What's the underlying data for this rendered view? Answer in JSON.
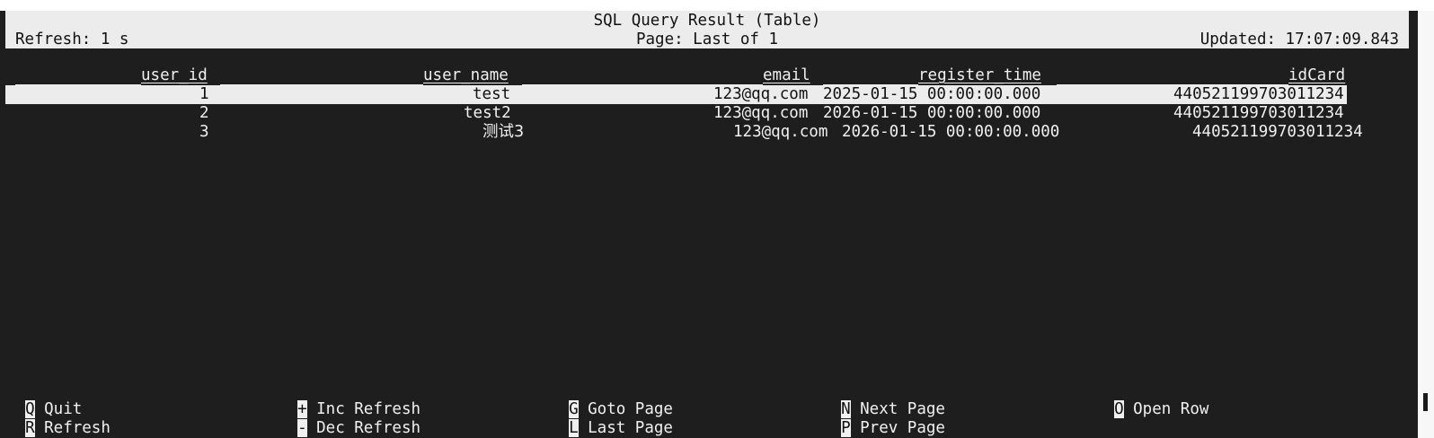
{
  "header": {
    "title": "SQL Query Result (Table)",
    "refresh": "Refresh: 1 s",
    "page": "Page: Last of 1",
    "updated": "Updated: 17:07:09.843"
  },
  "table": {
    "columns": [
      "user_id",
      "user_name",
      "email",
      "register_time",
      "idCard"
    ],
    "rows": [
      {
        "user_id": "1",
        "user_name": "test",
        "email": "123@qq.com",
        "register_time": "2025-01-15 00:00:00.000",
        "idCard": "440521199703011234"
      },
      {
        "user_id": "2",
        "user_name": "test2",
        "email": "123@qq.com",
        "register_time": "2026-01-15 00:00:00.000",
        "idCard": "440521199703011234"
      },
      {
        "user_id": "3",
        "user_name": "测试3",
        "email": "123@qq.com",
        "register_time": "2026-01-15 00:00:00.000",
        "idCard": "440521199703011234"
      }
    ]
  },
  "footer": {
    "shortcuts": [
      {
        "key": "Q",
        "label": "Quit"
      },
      {
        "key": "R",
        "label": "Refresh"
      },
      {
        "key": "+",
        "label": "Inc Refresh"
      },
      {
        "key": "-",
        "label": "Dec Refresh"
      },
      {
        "key": "G",
        "label": "Goto Page"
      },
      {
        "key": "L",
        "label": "Last Page"
      },
      {
        "key": "N",
        "label": "Next Page"
      },
      {
        "key": "P",
        "label": "Prev Page"
      },
      {
        "key": "O",
        "label": "Open Row"
      }
    ]
  },
  "colors": {
    "background": "#1e1e1e",
    "header_bg": "#ececec",
    "text": "#f0f0f0",
    "selected_row_bg": "#ececec"
  }
}
